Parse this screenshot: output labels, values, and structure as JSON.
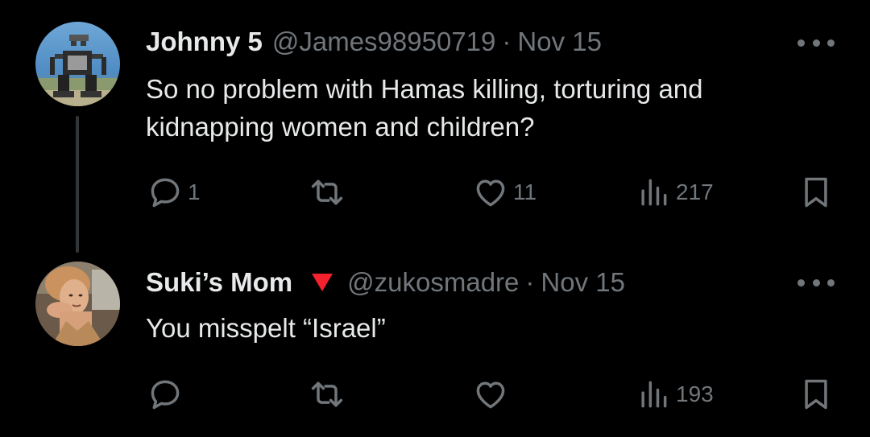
{
  "tweets": [
    {
      "name": "Johnny 5",
      "handle": "@James98950719",
      "separator": "·",
      "date": "Nov 15",
      "text": "So no problem with Hamas killing, torturing and kidnapping women and children?",
      "replies": "1",
      "retweets": "",
      "likes": "11",
      "views": "217",
      "avatar_icon": "robot-avatar"
    },
    {
      "name": "Suki’s Mom",
      "badge_icon": "red-triangle-icon",
      "handle": "@zukosmadre",
      "separator": "·",
      "date": "Nov 15",
      "text": "You misspelt “Israel”",
      "replies": "",
      "retweets": "",
      "likes": "",
      "views": "193",
      "avatar_icon": "person-avatar"
    }
  ],
  "colors": {
    "background": "#000000",
    "primary_text": "#e7e9ea",
    "secondary_text": "#71767b",
    "thread_line": "#333639",
    "badge_red": "#f4212e"
  }
}
